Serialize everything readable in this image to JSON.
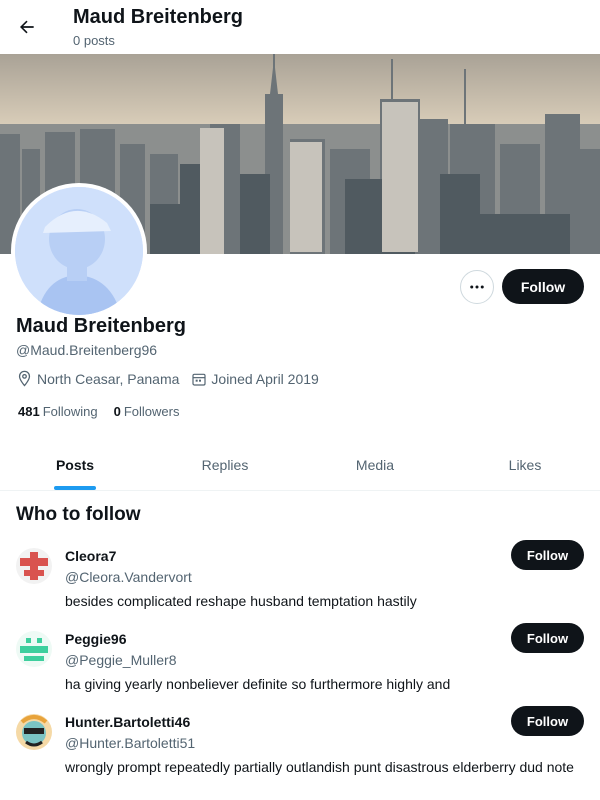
{
  "header": {
    "back_icon": "arrow-left-icon",
    "name": "Maud Breitenberg",
    "post_count": "0 posts"
  },
  "profile": {
    "name": "Maud Breitenberg",
    "handle": "@Maud.Breitenberg96",
    "location": "North Ceasar, Panama",
    "joined": "Joined April 2019",
    "following_count": "481",
    "following_label": "Following",
    "followers_count": "0",
    "followers_label": "Followers",
    "follow_label": "Follow",
    "more_icon": "more-dots-icon"
  },
  "tabs": [
    {
      "label": "Posts",
      "active": true
    },
    {
      "label": "Replies",
      "active": false
    },
    {
      "label": "Media",
      "active": false
    },
    {
      "label": "Likes",
      "active": false
    }
  ],
  "who_to_follow": {
    "title": "Who to follow",
    "items": [
      {
        "name": "Cleora7",
        "handle": "@Cleora.Vandervort",
        "bio": "besides complicated reshape husband temptation hastily",
        "follow_label": "Follow",
        "avatar_color": "#d9534f"
      },
      {
        "name": "Peggie96",
        "handle": "@Peggie_Muller8",
        "bio": "ha giving yearly nonbeliever definite so furthermore highly and",
        "follow_label": "Follow",
        "avatar_color": "#3ecf9e"
      },
      {
        "name": "Hunter.Bartoletti46",
        "handle": "@Hunter.Bartoletti51",
        "bio": "wrongly prompt repeatedly partially outlandish punt disastrous elderberry dud note",
        "follow_label": "Follow",
        "avatar_color": "#e8a33b"
      }
    ]
  },
  "colors": {
    "accent": "#1d9bf0",
    "button_dark": "#0f1419",
    "secondary_text": "#536471"
  }
}
